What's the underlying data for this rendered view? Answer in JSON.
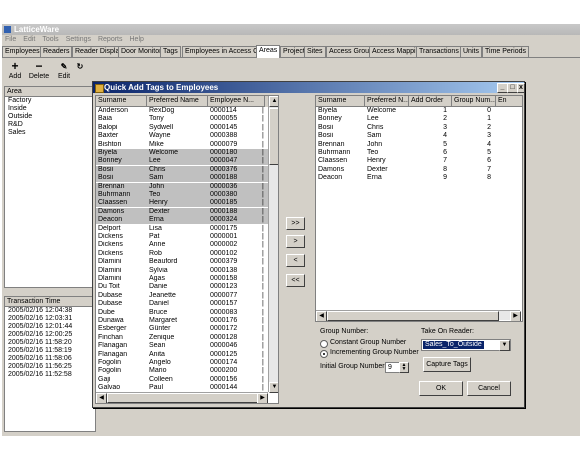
{
  "app": {
    "title": "LatticeWare"
  },
  "menu": [
    "File",
    "Edit",
    "Tools",
    "Settings",
    "Reports",
    "Help"
  ],
  "tabs": [
    "Employees",
    "Readers",
    "Reader Display",
    "Door Monitor",
    "Tags",
    "Employees in Access Groups",
    "Areas",
    "Projects",
    "Sites",
    "Access Groups",
    "Access Mapping",
    "Transactions",
    "Units",
    "Time Periods"
  ],
  "active_tab": "Areas",
  "toolbar": {
    "add": "Add",
    "delete": "Delete",
    "edit": "Edit"
  },
  "areas": {
    "header": "Area",
    "items": [
      "Factory",
      "Inside",
      "Outside",
      "R&D",
      "Sales"
    ]
  },
  "transactions": {
    "header": "Transaction Time",
    "items": [
      "2005/02/16 12:04:38",
      "2005/02/16 12:03:31",
      "2005/02/16 12:01:44",
      "2005/02/16 12:00:25",
      "2005/02/16 11:58:20",
      "2005/02/16 11:58:19",
      "2005/02/16 11:58:06",
      "2005/02/16 11:56:25",
      "2005/02/16 11:52:58"
    ]
  },
  "dialog": {
    "title": "Quick Add Tags to Employees",
    "left_grid": {
      "columns": [
        "Surname",
        "Preferred Name",
        "Employee N..."
      ],
      "rows": [
        {
          "surname": "Anderson",
          "pref": "RexDog",
          "emp": "0000114",
          "sel": false
        },
        {
          "surname": "Baia",
          "pref": "Tony",
          "emp": "0000055",
          "sel": false
        },
        {
          "surname": "Balopi",
          "pref": "Sydwell",
          "emp": "0000145",
          "sel": false
        },
        {
          "surname": "Baxter",
          "pref": "Wayne",
          "emp": "0000388",
          "sel": false
        },
        {
          "surname": "Bishton",
          "pref": "Mike",
          "emp": "0000079",
          "sel": false
        },
        {
          "surname": "Biyela",
          "pref": "Welcome",
          "emp": "0000180",
          "sel": true
        },
        {
          "surname": "Bonney",
          "pref": "Lee",
          "emp": "0000047",
          "sel": true
        },
        {
          "surname": "Bosii",
          "pref": "Chris",
          "emp": "0000376",
          "sel": true
        },
        {
          "surname": "Bosii",
          "pref": "Sam",
          "emp": "0000188",
          "sel": true
        },
        {
          "surname": "Brennan",
          "pref": "John",
          "emp": "0000036",
          "sel": true
        },
        {
          "surname": "Buhrmann",
          "pref": "Teo",
          "emp": "0000380",
          "sel": true
        },
        {
          "surname": "Claassen",
          "pref": "Henry",
          "emp": "0000185",
          "sel": true
        },
        {
          "surname": "Damons",
          "pref": "Dexter",
          "emp": "0000188",
          "sel": true
        },
        {
          "surname": "Deacon",
          "pref": "Erna",
          "emp": "0000324",
          "sel": true
        },
        {
          "surname": "Delport",
          "pref": "Lisa",
          "emp": "0000175",
          "sel": false
        },
        {
          "surname": "Dickens",
          "pref": "Pat",
          "emp": "0000001",
          "sel": false
        },
        {
          "surname": "Dickens",
          "pref": "Anne",
          "emp": "0000002",
          "sel": false
        },
        {
          "surname": "Dickens",
          "pref": "Rob",
          "emp": "0000102",
          "sel": false
        },
        {
          "surname": "Dlamini",
          "pref": "Beauford",
          "emp": "0000379",
          "sel": false
        },
        {
          "surname": "Dlamini",
          "pref": "Sylvia",
          "emp": "0000138",
          "sel": false
        },
        {
          "surname": "Dlamini",
          "pref": "Agas",
          "emp": "0000158",
          "sel": false
        },
        {
          "surname": "Du Toit",
          "pref": "Danie",
          "emp": "0000123",
          "sel": false
        },
        {
          "surname": "Dubase",
          "pref": "Jeanette",
          "emp": "0000077",
          "sel": false
        },
        {
          "surname": "Dubase",
          "pref": "Daniel",
          "emp": "0000157",
          "sel": false
        },
        {
          "surname": "Dube",
          "pref": "Bruce",
          "emp": "0000083",
          "sel": false
        },
        {
          "surname": "Dunawa",
          "pref": "Margaret",
          "emp": "0000176",
          "sel": false
        },
        {
          "surname": "Esberger",
          "pref": "Günter",
          "emp": "0000172",
          "sel": false
        },
        {
          "surname": "Finchan",
          "pref": "Zenique",
          "emp": "0000128",
          "sel": false
        },
        {
          "surname": "Flanagan",
          "pref": "Sean",
          "emp": "0000046",
          "sel": false
        },
        {
          "surname": "Flanagan",
          "pref": "Anita",
          "emp": "0000125",
          "sel": false
        },
        {
          "surname": "Fogolin",
          "pref": "Angelo",
          "emp": "0000174",
          "sel": false
        },
        {
          "surname": "Fogolin",
          "pref": "Mario",
          "emp": "0000200",
          "sel": false
        },
        {
          "surname": "Gaji",
          "pref": "Colleen",
          "emp": "0000156",
          "sel": false
        },
        {
          "surname": "Galvao",
          "pref": "Paul",
          "emp": "0000144",
          "sel": false
        }
      ]
    },
    "move_buttons": [
      ">>",
      ">",
      "<",
      "<<"
    ],
    "right_grid": {
      "columns": [
        "Surname",
        "Preferred N...",
        "Add Order",
        "Group Num...",
        "En"
      ],
      "rows": [
        {
          "surname": "Biyela",
          "pref": "Welcome",
          "order": "1",
          "group": "0"
        },
        {
          "surname": "Bonney",
          "pref": "Lee",
          "order": "2",
          "group": "1"
        },
        {
          "surname": "Bosii",
          "pref": "Chris",
          "order": "3",
          "group": "2"
        },
        {
          "surname": "Bosii",
          "pref": "Sam",
          "order": "4",
          "group": "3"
        },
        {
          "surname": "Brennan",
          "pref": "John",
          "order": "5",
          "group": "4"
        },
        {
          "surname": "Buhrmann",
          "pref": "Teo",
          "order": "6",
          "group": "5"
        },
        {
          "surname": "Claassen",
          "pref": "Henry",
          "order": "7",
          "group": "6"
        },
        {
          "surname": "Damons",
          "pref": "Dexter",
          "order": "8",
          "group": "7"
        },
        {
          "surname": "Deacon",
          "pref": "Erna",
          "order": "9",
          "group": "8"
        }
      ]
    },
    "group_number_label": "Group Number:",
    "radio_constant": "Constant Group Number",
    "radio_incrementing": "Incrementing Group Number",
    "initial_group_label": "Initial Group Number:",
    "initial_group_value": "9",
    "take_on_reader_label": "Take On Reader:",
    "take_on_reader_value": "Sales_To_Outside",
    "capture_button": "Capture Tags",
    "ok_button": "OK",
    "cancel_button": "Cancel"
  }
}
